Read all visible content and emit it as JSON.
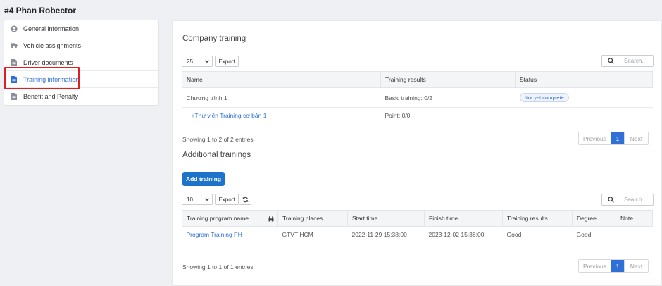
{
  "page": {
    "title": "#4 Phan Robector"
  },
  "sidebar": {
    "items": [
      {
        "label": "General information",
        "icon": "user-circle-icon"
      },
      {
        "label": "Vehicle assignments",
        "icon": "truck-icon"
      },
      {
        "label": "Driver documents",
        "icon": "document-icon"
      },
      {
        "label": "Training information",
        "icon": "document-icon"
      },
      {
        "label": "Benefit and Penalty",
        "icon": "document-icon"
      }
    ],
    "active_index": 3
  },
  "company_training": {
    "title": "Company training",
    "page_size": "25",
    "export_label": "Export",
    "search_placeholder": "Search..",
    "headers": [
      "Name",
      "Training results",
      "Status"
    ],
    "rows": [
      {
        "name": "Chương trình 1",
        "result": "Basic training: 0/2",
        "status": "Not yet complete"
      },
      {
        "name": "+Thư viện Training cơ bản 1",
        "result": "Point: 0/0",
        "status": ""
      }
    ],
    "entries_text": "Showing 1 to 2 of 2 entries",
    "pagination": {
      "previous": "Previous",
      "current": "1",
      "next": "Next"
    }
  },
  "additional_trainings": {
    "title": "Additional trainings",
    "add_button": "Add training",
    "page_size": "10",
    "export_label": "Export",
    "search_placeholder": "Search..",
    "headers": [
      "Training program name",
      "Training places",
      "Start time",
      "Finish time",
      "Training results",
      "Degree",
      "Note"
    ],
    "rows": [
      {
        "name": "Program Training PH",
        "place": "GTVT HCM",
        "start": "2022-11-29 15:38:00",
        "finish": "2023-12-02 15:38:00",
        "result": "Good",
        "degree": "Good",
        "note": ""
      }
    ],
    "entries_text": "Showing 1 to 1 of 1 entries",
    "pagination": {
      "previous": "Previous",
      "current": "1",
      "next": "Next"
    }
  },
  "colors": {
    "accent": "#2f6fd6",
    "button": "#1d73c9",
    "highlight": "#e02020"
  }
}
